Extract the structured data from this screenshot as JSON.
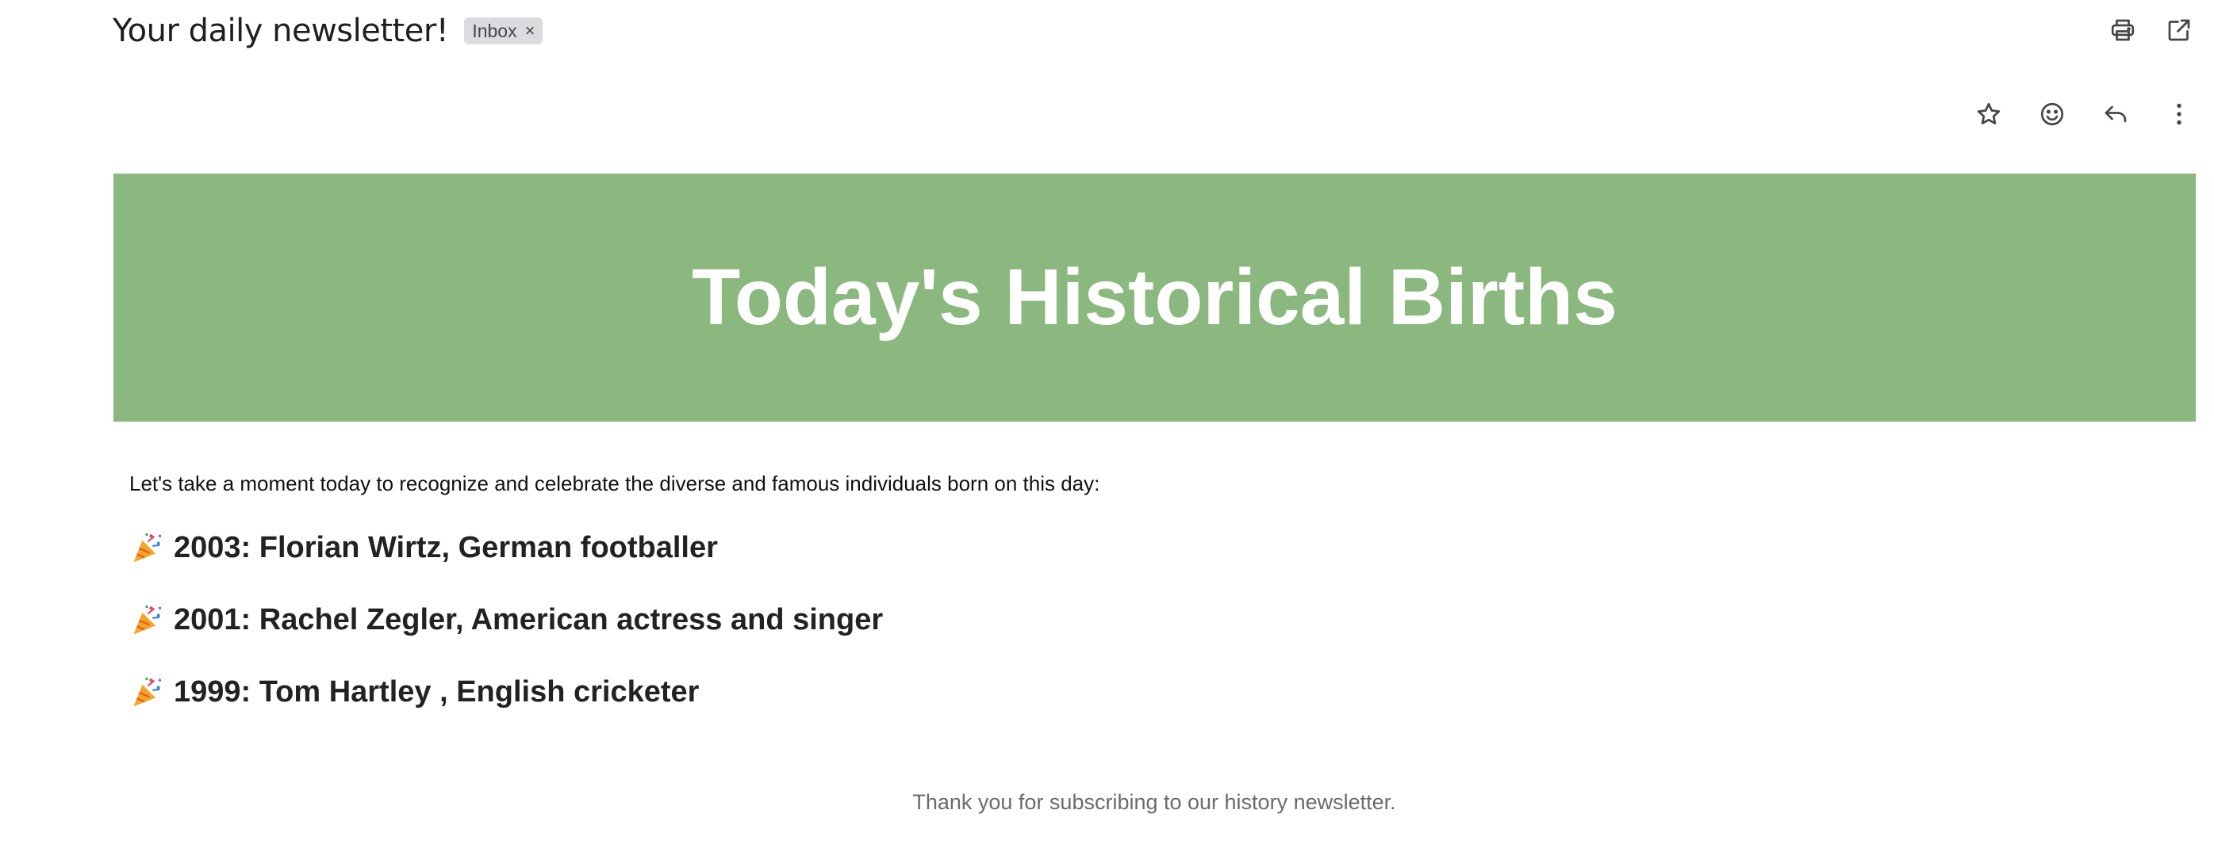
{
  "email": {
    "subject": "Your daily newsletter!",
    "label_chip": "Inbox",
    "label_remove": "×"
  },
  "toolbar": {
    "print_icon": "print-icon",
    "open_in_new_icon": "open-in-new-window-icon",
    "star_icon": "star-icon",
    "emoji_icon": "add-reaction-icon",
    "reply_icon": "reply-icon",
    "more_icon": "more-vert-icon"
  },
  "newsletter": {
    "banner_title": "Today's Historical Births",
    "banner_color": "#8ab87e",
    "intro": "Let's take a moment today to recognize and celebrate the diverse and famous individuals born on this day:",
    "births": [
      {
        "icon": "party-popper-icon",
        "text": "2003: Florian Wirtz, German footballer"
      },
      {
        "icon": "party-popper-icon",
        "text": "2001: Rachel Zegler, American actress and singer"
      },
      {
        "icon": "party-popper-icon",
        "text": "1999: Tom Hartley , English cricketer"
      }
    ],
    "footer": "Thank you for subscribing to our history newsletter."
  }
}
